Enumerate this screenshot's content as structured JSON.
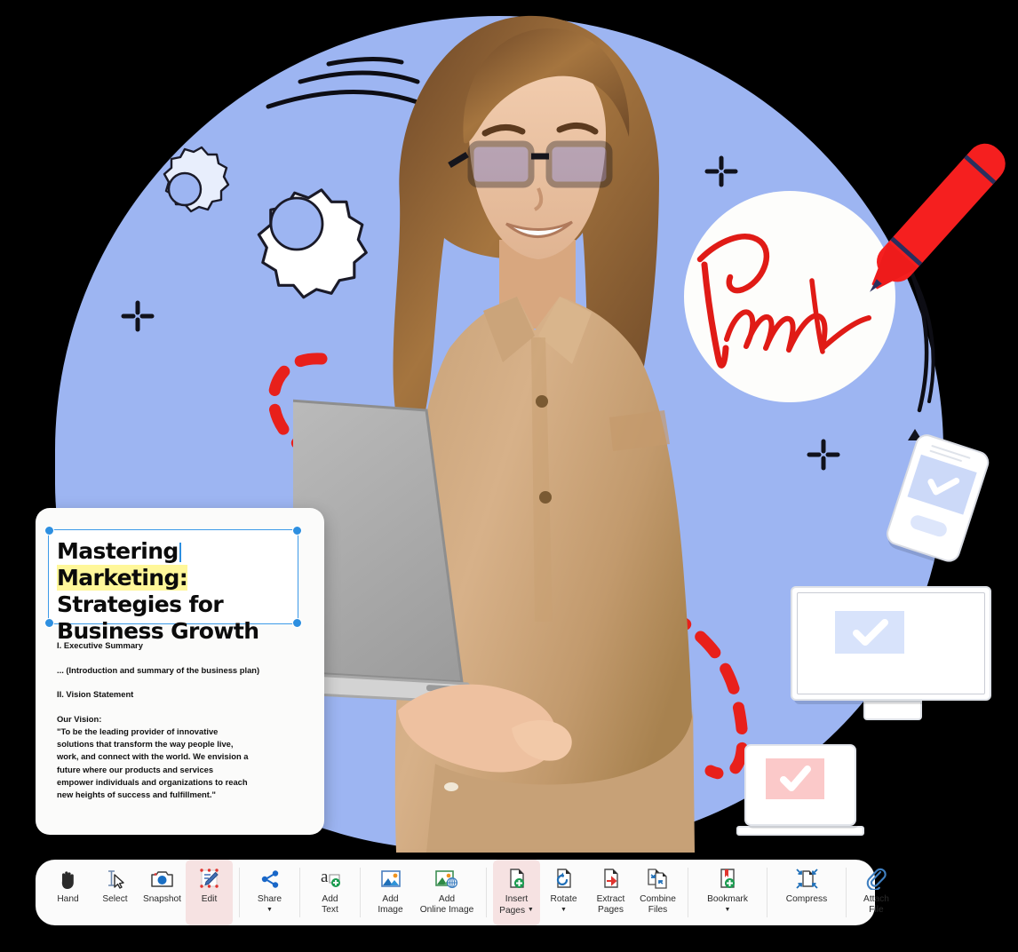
{
  "document_card": {
    "title_part1": "Mastering",
    "title_highlight": "Marketing:",
    "title_line2": "Strategies for",
    "title_line3": "Business Growth",
    "heading_1": "I. Executive Summary",
    "para_1": "... (Introduction and summary of the business plan)",
    "heading_2": "II. Vision Statement",
    "vision_label": "Our Vision:",
    "vision_l1": "\"To be the leading provider of innovative",
    "vision_l2": "solutions that transform the way people live,",
    "vision_l3": "work, and connect with the world. We envision a",
    "vision_l4": "future where our products and services",
    "vision_l5": " empower individuals and organizations to reach",
    "vision_l6": "new heights of success and fulfillment.\""
  },
  "toolbar": {
    "groups": [
      {
        "buttons": [
          {
            "label": "Hand",
            "icon": "hand-icon",
            "active": false,
            "caret": false
          },
          {
            "label": "Select",
            "icon": "select-icon",
            "active": false,
            "caret": false
          },
          {
            "label": "Snapshot",
            "icon": "snapshot-icon",
            "active": false,
            "caret": false
          },
          {
            "label": "Edit",
            "icon": "edit-icon",
            "active": true,
            "caret": false
          }
        ]
      },
      {
        "buttons": [
          {
            "label": "Share",
            "icon": "share-icon",
            "active": false,
            "caret": true
          }
        ]
      },
      {
        "buttons": [
          {
            "label_l1": "Add",
            "label_l2": "Text",
            "icon": "add-text-icon",
            "active": false,
            "caret": false
          }
        ]
      },
      {
        "buttons": [
          {
            "label_l1": "Add",
            "label_l2": "Image",
            "icon": "add-image-icon",
            "active": false,
            "caret": false
          },
          {
            "label_l1": "Add",
            "label_l2": "Online Image",
            "icon": "add-online-image-icon",
            "active": false,
            "caret": false
          }
        ]
      },
      {
        "buttons": [
          {
            "label_l1": "Insert",
            "label_l2": "Pages",
            "icon": "insert-pages-icon",
            "active": true,
            "caret": true
          },
          {
            "label_l1": "Rotate",
            "label_l2": "",
            "icon": "rotate-icon",
            "active": false,
            "caret": true
          },
          {
            "label_l1": "Extract",
            "label_l2": "Pages",
            "icon": "extract-pages-icon",
            "active": false,
            "caret": false
          },
          {
            "label_l1": "Combine",
            "label_l2": "Files",
            "icon": "combine-files-icon",
            "active": false,
            "caret": false
          }
        ]
      },
      {
        "buttons": [
          {
            "label_l1": "Bookmark",
            "label_l2": "",
            "icon": "bookmark-icon",
            "active": false,
            "caret": true
          }
        ]
      },
      {
        "buttons": [
          {
            "label_l1": "Compress",
            "label_l2": "",
            "icon": "compress-icon",
            "active": false,
            "caret": false
          }
        ]
      },
      {
        "buttons": [
          {
            "label_l1": "Attach",
            "label_l2": "File",
            "icon": "attach-file-icon",
            "active": false,
            "caret": false
          }
        ]
      }
    ]
  },
  "colors": {
    "background": "#000000",
    "blob": "#9db5f2",
    "accent_blue": "#2d8fe0",
    "signature_red": "#e01b16",
    "highlight_yellow": "#fff79a",
    "active_tool_bg": "#f6e2e2",
    "toolbar_bg": "#fbfbfb",
    "card_bg": "#fbfbfa",
    "pink_screen": "#fbc9c9",
    "blue_screen": "#d8e3fb"
  },
  "decor": {
    "gear_large": "gear-icon",
    "gear_small": "gear-icon",
    "signature": "signature-scribble",
    "pen": "red-pen-icon",
    "dashed_path": "red-dashed-curve",
    "plus_marks": 3,
    "triangle_mark": "triangle-icon"
  }
}
